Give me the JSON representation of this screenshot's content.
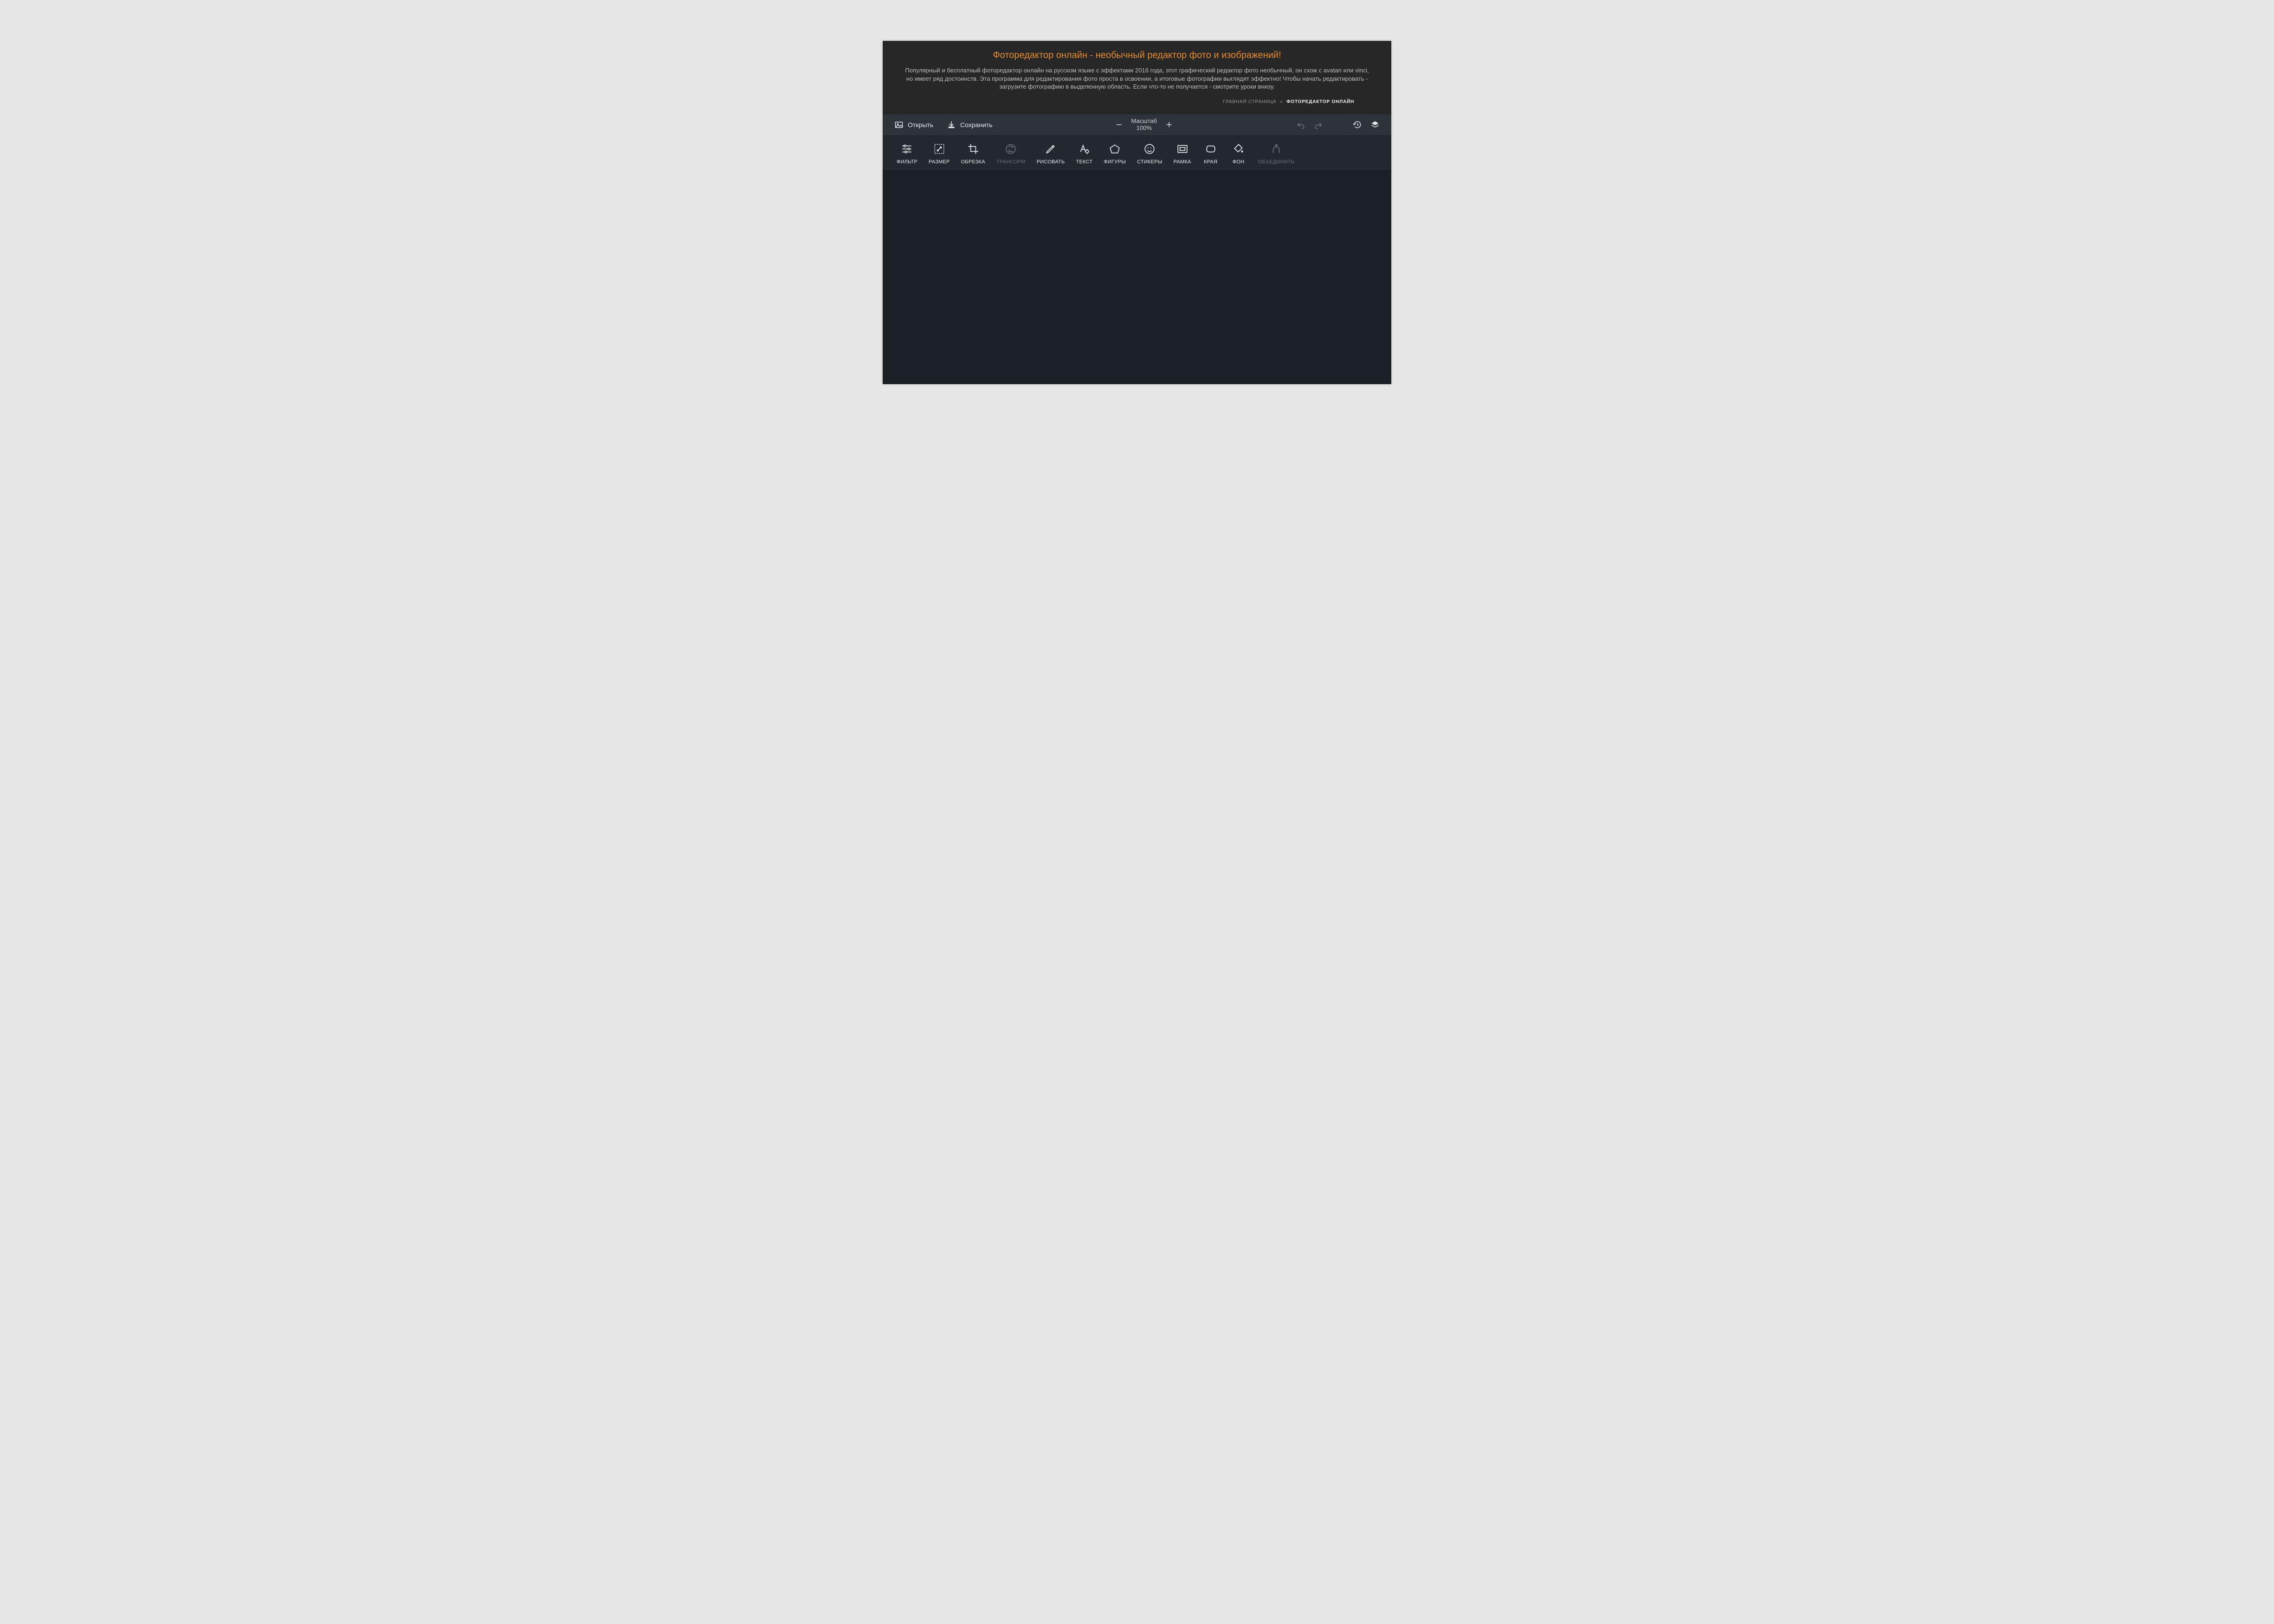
{
  "header": {
    "title": "Фоторедактор онлайн - необычный редактор фото и изображений!",
    "description": "Популярный и бесплатный фоторедактор онлайн на русском языке с эффектами 2016 года, этот графический редактор фото необычный, он схож с avatan или vinci, но имеет ряд достоинств. Эта программа для редактирования фото проста в освоении, а итоговые фотографии выглядят эффектно! Чтобы начать редактировать - загрузите фотографию в выделенную область. Если что-то не получается - смотрите уроки внизу."
  },
  "breadcrumb": {
    "home": "ГЛАВНАЯ СТРАНИЦА",
    "sep": "»",
    "current": "ФОТОРЕДАКТОР ОНЛАЙН"
  },
  "topbar": {
    "open": "Открыть",
    "save": "Сохранить",
    "zoom_label": "Масштаб",
    "zoom_value": "100%"
  },
  "tools": {
    "filter": "ФИЛЬТР",
    "resize": "РАЗМЕР",
    "crop": "ОБРЕЗКА",
    "transform": "ТРАНСОРМ",
    "draw": "РИСОВАТЬ",
    "text": "ТЕКСТ",
    "shapes": "ФИГУРЫ",
    "stickers": "СТИКЕРЫ",
    "frame": "РАМКА",
    "corners": "КРАЯ",
    "background": "ФОН",
    "merge": "ОБЪЕДИНИТЬ"
  }
}
